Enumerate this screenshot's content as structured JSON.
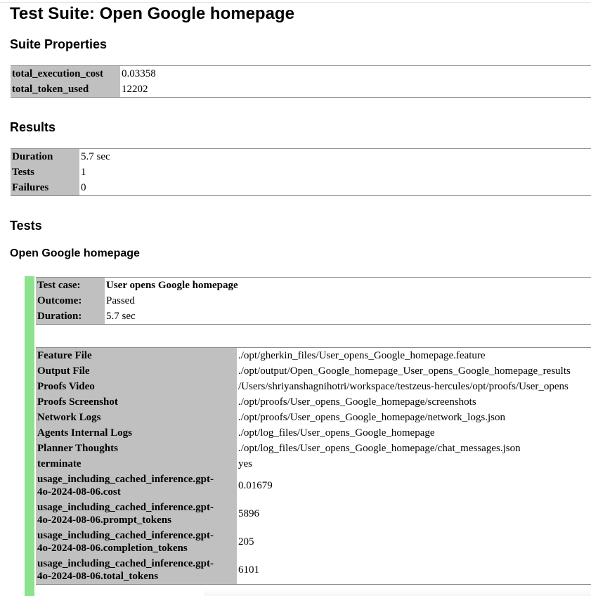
{
  "suite": {
    "title": "Test Suite: Open Google homepage"
  },
  "suite_properties": {
    "heading": "Suite Properties",
    "rows": [
      {
        "key": "total_execution_cost",
        "value": "0.03358"
      },
      {
        "key": "total_token_used",
        "value": "12202"
      }
    ]
  },
  "results": {
    "heading": "Results",
    "rows": [
      {
        "key": "Duration",
        "value": "5.7 sec"
      },
      {
        "key": "Tests",
        "value": "1"
      },
      {
        "key": "Failures",
        "value": "0"
      }
    ]
  },
  "tests": {
    "heading": "Tests",
    "feature_heading": "Open Google homepage",
    "test_case": {
      "rows": [
        {
          "key": "Test case:",
          "value": "User opens Google homepage"
        },
        {
          "key": "Outcome:",
          "value": "Passed"
        },
        {
          "key": "Duration:",
          "value": "5.7 sec"
        }
      ]
    },
    "details": {
      "rows": [
        {
          "key": "Feature File",
          "value": "./opt/gherkin_files/User_opens_Google_homepage.feature"
        },
        {
          "key": "Output File",
          "value": "./opt/output/Open_Google_homepage_User_opens_Google_homepage_results"
        },
        {
          "key": "Proofs Video",
          "value": "/Users/shriyanshagnihotri/workspace/testzeus-hercules/opt/proofs/User_opens"
        },
        {
          "key": "Proofs Screenshot",
          "value": "./opt/proofs/User_opens_Google_homepage/screenshots"
        },
        {
          "key": "Network Logs",
          "value": "./opt/proofs/User_opens_Google_homepage/network_logs.json"
        },
        {
          "key": "Agents Internal Logs",
          "value": "./opt/log_files/User_opens_Google_homepage"
        },
        {
          "key": "Planner Thoughts",
          "value": "./opt/log_files/User_opens_Google_homepage/chat_messages.json"
        },
        {
          "key": "terminate",
          "value": "yes"
        },
        {
          "key_line1": "usage_including_cached_inference.gpt-",
          "key_line2": "4o-2024-08-06.cost",
          "value": "0.01679"
        },
        {
          "key_line1": "usage_including_cached_inference.gpt-",
          "key_line2": "4o-2024-08-06.prompt_tokens",
          "value": "5896"
        },
        {
          "key_line1": "usage_including_cached_inference.gpt-",
          "key_line2": "4o-2024-08-06.completion_tokens",
          "value": "205"
        },
        {
          "key_line1": "usage_including_cached_inference.gpt-",
          "key_line2": "4o-2024-08-06.total_tokens",
          "value": "6101"
        }
      ]
    }
  },
  "colors": {
    "key_cell_bg": "#c0c0c0",
    "pass_bar": "#8de28d",
    "table_border": "#8c8c8c"
  }
}
